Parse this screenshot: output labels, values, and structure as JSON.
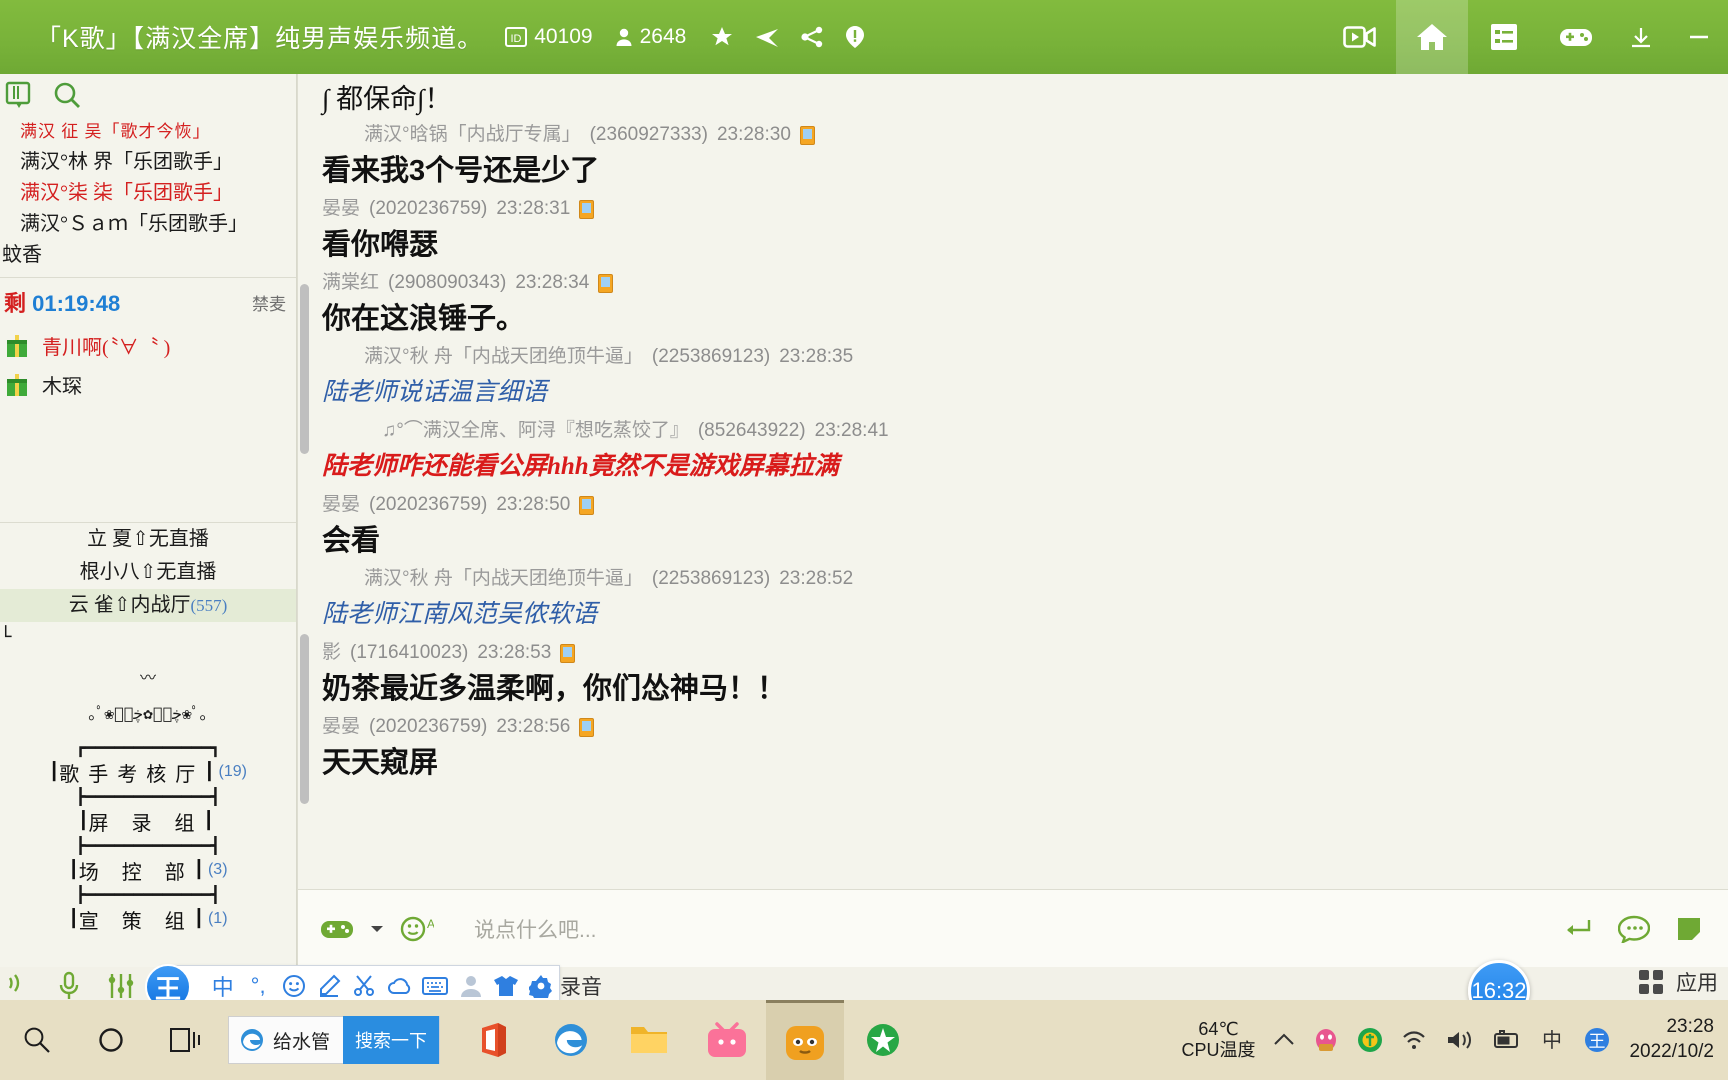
{
  "titlebar": {
    "room_title": "「K歌」【满汉全席】纯男声娱乐频道。",
    "id_label": "40109",
    "viewers": "2648",
    "icons": [
      "id-card-icon",
      "user-count-icon",
      "star-icon",
      "broadcast-icon",
      "share-icon",
      "report-icon"
    ],
    "right_buttons": [
      "video-icon",
      "home-icon",
      "list-icon",
      "game-icon",
      "minimize-icon",
      "close-icon"
    ],
    "accent": "#78b239"
  },
  "sidebar": {
    "tools": [
      "channel-icon",
      "search-icon"
    ],
    "mic_queue": [
      {
        "text": "满汉 征 吴「歌才今恢」",
        "style": "tiny"
      },
      {
        "text": "满汉°林 界「乐团歌手」",
        "style": "dark"
      },
      {
        "text": "满汉°柒 柒「乐团歌手」",
        "style": "red"
      },
      {
        "text": "满汉°Ｓａｍ「乐团歌手」",
        "style": "dark"
      },
      {
        "text": "蚊香",
        "style": "dark"
      }
    ],
    "timer": {
      "prefix": "剩",
      "value": "01:19:48",
      "mute_label": "禁麦"
    },
    "gifts": [
      {
        "name": "青川啊(〝∀〝 )",
        "color": "red"
      },
      {
        "name": "木琛",
        "color": "dark"
      }
    ],
    "rooms": [
      {
        "name": "立 夏⇧无直播",
        "count": "",
        "selected": false
      },
      {
        "name": "根小八⇧无直播",
        "count": "",
        "selected": false
      },
      {
        "name": "云 雀⇧内战厅",
        "count": "(557)",
        "selected": true
      }
    ],
    "decor_top": "└                             ┘",
    "decor_mid": "〰",
    "decor_art": "｡ﾟ❀ڿڰۣ✿ڿڰۣ❀ﾟ｡",
    "departments": [
      {
        "name": "歌手考核厅",
        "count": "(19)"
      },
      {
        "name": "屏 录 组",
        "count": ""
      },
      {
        "name": "场 控 部",
        "count": "(3)"
      },
      {
        "name": "宣 策 组",
        "count": "(1)"
      }
    ]
  },
  "chat": {
    "messages": [
      {
        "indent": false,
        "header": "",
        "nick": "",
        "uid": "",
        "time": "",
        "body": "∫ 都保命∫！",
        "body_style": "top"
      },
      {
        "indent": true,
        "nick": "满汉°晗锅「内战厅专属」",
        "uid": "(2360927333)",
        "time": "23:28:30",
        "body": "看来我3个号还是少了",
        "body_style": "sans"
      },
      {
        "indent": false,
        "nick": "晏晏",
        "uid": "(2020236759)",
        "time": "23:28:31",
        "body": "看你嘚瑟",
        "body_style": "sans"
      },
      {
        "indent": false,
        "nick": "满棠红",
        "uid": "(2908090343)",
        "time": "23:28:34",
        "body": "你在这浪锤子。",
        "body_style": "sans"
      },
      {
        "indent": true,
        "nick": "满汉°秋 舟「内战天团绝顶牛逼」",
        "uid": "(2253869123)",
        "time": "23:28:35",
        "body": "陆老师说话温言细语",
        "body_style": "blue"
      },
      {
        "indent": true,
        "nick": "♫°⌒满汉全席、阿浔『想吃蒸饺了』",
        "uid": "(852643922)",
        "time": "23:28:41",
        "body": "陆老师咋还能看公屏hhh竟然不是游戏屏幕拉满",
        "body_style": "red"
      },
      {
        "indent": false,
        "nick": "晏晏",
        "uid": "(2020236759)",
        "time": "23:28:50",
        "body": "会看",
        "body_style": "sans"
      },
      {
        "indent": true,
        "nick": "满汉°秋 舟「内战天团绝顶牛逼」",
        "uid": "(2253869123)",
        "time": "23:28:52",
        "body": "陆老师江南风范吴侬软语",
        "body_style": "blue"
      },
      {
        "indent": false,
        "nick": "影",
        "uid": "(1716410023)",
        "time": "23:28:53",
        "body": "奶茶最近多温柔啊，你们怂神马！！",
        "body_style": "sans"
      },
      {
        "indent": false,
        "nick": "晏晏",
        "uid": "(2020236759)",
        "time": "23:28:56",
        "body": "天天窥屏",
        "body_style": "sans"
      }
    ],
    "input": {
      "placeholder": "说点什么吧...",
      "left_icons": [
        "game-icon",
        "chevron-down-icon",
        "emoji-text-icon"
      ],
      "right_icons": [
        "enter-icon",
        "chat-bubble-icon",
        "sticker-icon"
      ]
    }
  },
  "ime": {
    "logo": "王",
    "items": [
      "中",
      "°,",
      "emoji-icon",
      "pen-icon",
      "scissors-icon",
      "cloud-icon",
      "keyboard-icon",
      "user-icon",
      "shirt-icon",
      "gear-icon"
    ],
    "left_icons": [
      "speaker-icon",
      "mic-icon",
      "equalizer-icon"
    ],
    "tail_text": "录音"
  },
  "clock_bubble": {
    "time": "16:32"
  },
  "desktop_corner": {
    "label": "应用",
    "icon": "grid-icon"
  },
  "taskbar": {
    "left_icons": [
      "search-icon",
      "cortana-icon",
      "taskview-icon"
    ],
    "search": {
      "value": "给水管",
      "button": "搜索一下",
      "icon": "edge-legacy-icon"
    },
    "apps": [
      "office-icon",
      "edge-icon",
      "explorer-icon",
      "bilibili-icon",
      "raccoon-icon",
      "feixin-icon"
    ],
    "tray": {
      "cpu_temp": "64℃",
      "cpu_label": "CPU温度",
      "icons": [
        "chevron-up-icon",
        "qq-icon",
        "security-icon",
        "wifi-icon",
        "volume-icon",
        "battery-icon",
        "ime-cn-icon",
        "wangzhe-icon"
      ],
      "time": "23:28",
      "date": "2022/10/2"
    }
  }
}
